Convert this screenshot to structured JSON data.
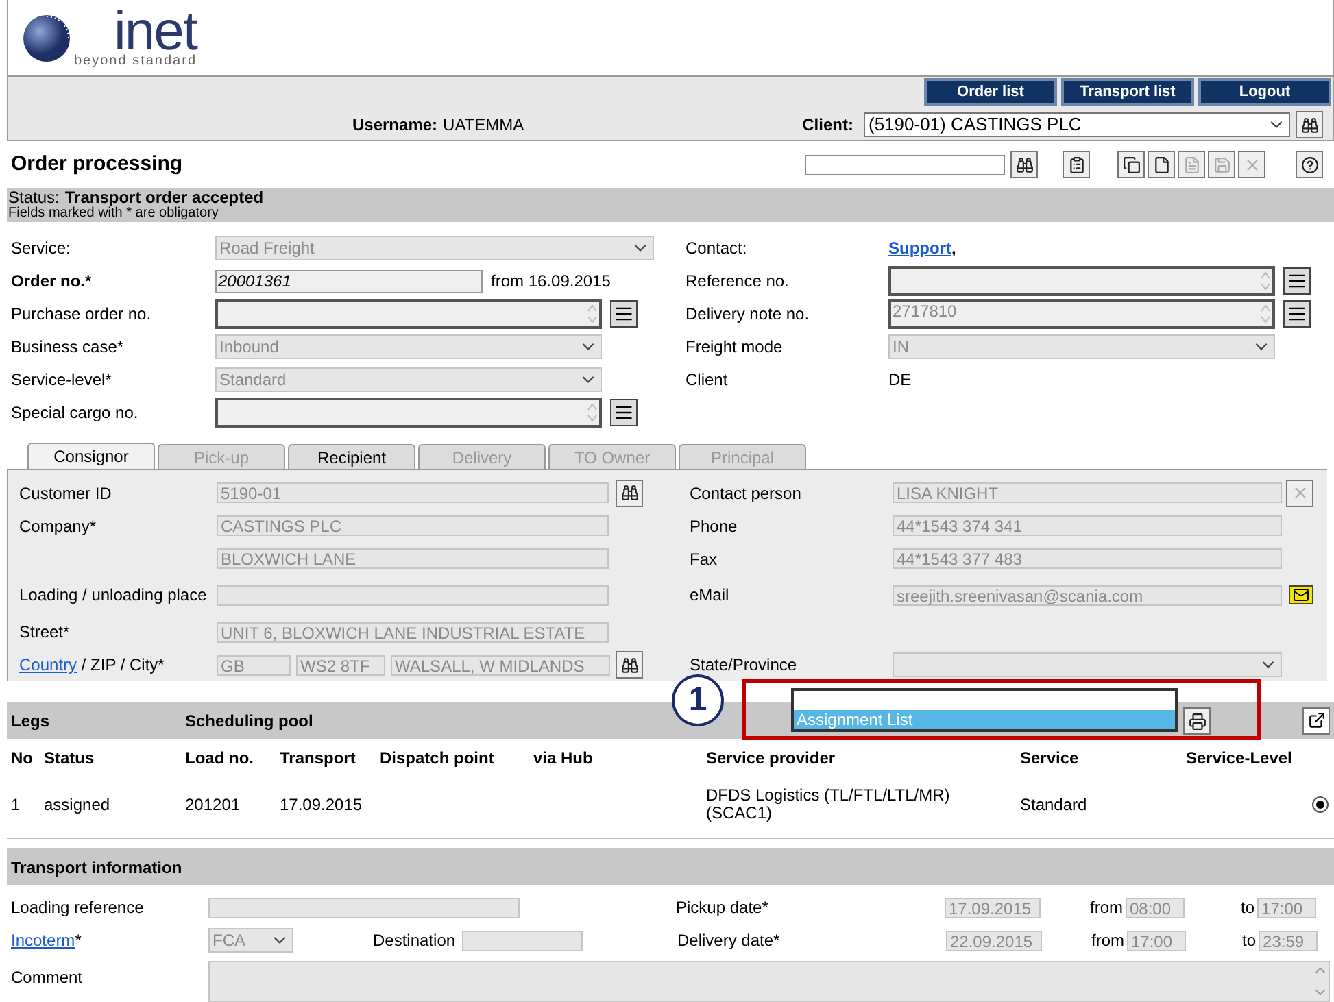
{
  "logo": {
    "wordmark": "inet",
    "tagline": "beyond standard"
  },
  "nav_buttons": [
    "Order list",
    "Transport list",
    "Logout"
  ],
  "username": {
    "label": "Username:",
    "value": "UATEMMA"
  },
  "client": {
    "label": "Client:",
    "value": "(5190-01) CASTINGS PLC"
  },
  "page_title": "Order processing",
  "status": {
    "label": "Status:",
    "value": "Transport order accepted",
    "note": "Fields marked with * are obligatory"
  },
  "order_rows": [
    {
      "left": {
        "label": "Service:",
        "primary": false,
        "kind": "select",
        "value": "Road Freight"
      },
      "right": {
        "label": "Contact:",
        "kind": "link",
        "value": "Support",
        "suffix": ","
      }
    },
    {
      "left": {
        "label": "Order no.*",
        "primary": true,
        "kind": "text",
        "value": "20001361",
        "suffix": "from 16.09.2015"
      },
      "right": {
        "label": "Reference no.",
        "kind": "spinner"
      }
    },
    {
      "left": {
        "label": "Purchase order no.",
        "primary": false,
        "kind": "spinner"
      },
      "right": {
        "label": "Delivery note no.",
        "kind": "spinner",
        "value": "2717810"
      }
    },
    {
      "left": {
        "label": "Business case*",
        "primary": false,
        "kind": "select",
        "value": "Inbound"
      },
      "right": {
        "label": "Freight mode",
        "kind": "select",
        "value": "IN"
      }
    },
    {
      "left": {
        "label": "Service-level*",
        "primary": false,
        "kind": "select",
        "value": "Standard"
      },
      "right": {
        "label": "Client",
        "kind": "static",
        "value": "DE"
      }
    },
    {
      "left": {
        "label": "Special cargo no.",
        "primary": false,
        "kind": "spinner"
      }
    }
  ],
  "tabs": [
    {
      "label": "Consignor",
      "selected": true,
      "disabled": false
    },
    {
      "label": "Pick-up",
      "selected": false,
      "disabled": true
    },
    {
      "label": "Recipient",
      "selected": false,
      "disabled": false
    },
    {
      "label": "Delivery",
      "selected": false,
      "disabled": true
    },
    {
      "label": "TO Owner",
      "selected": false,
      "disabled": true
    },
    {
      "label": "Principal",
      "selected": false,
      "disabled": true
    }
  ],
  "consignor_rows": [
    {
      "left": {
        "label": "Customer ID",
        "kind": "lookup",
        "values": [
          "5190-01"
        ]
      },
      "right": {
        "label": "Contact person",
        "kind": "clear",
        "value": "LISA KNIGHT"
      }
    },
    {
      "left": {
        "label": "Company*",
        "kind": "text",
        "values": [
          "CASTINGS PLC"
        ]
      },
      "right": {
        "label": "Phone",
        "kind": "text",
        "value": "44*1543 374 341"
      }
    },
    {
      "left": {
        "kind": "text",
        "values": [
          "BLOXWICH LANE"
        ]
      },
      "right": {
        "label": "Fax",
        "kind": "text",
        "value": "44*1543 377 483"
      }
    },
    {
      "left": {
        "label": "Loading / unloading place",
        "kind": "text"
      },
      "right": {
        "label": "eMail",
        "kind": "mail",
        "value": "sreejith.sreenivasan@scania.com"
      }
    },
    {
      "left": {
        "label": "Street*",
        "kind": "text",
        "values": [
          "UNIT 6, BLOXWICH LANE INDUSTRIAL ESTATE"
        ]
      }
    },
    {
      "left": {
        "label_link": "Country",
        "label": " / ZIP / City*",
        "kind": "address",
        "values": [
          "GB",
          "WS2 8TF",
          "WALSALL, W MIDLANDS"
        ]
      },
      "right": {
        "label": "State/Province",
        "kind": "select"
      }
    }
  ],
  "legs": {
    "title": "Legs",
    "pool": "Scheduling pool",
    "callout": "1",
    "assignment_option": "Assignment List",
    "columns": [
      "No",
      "Status",
      "Load no.",
      "Transport",
      "Dispatch point",
      "via Hub",
      "Service provider",
      "Service",
      "Service-Level"
    ],
    "rows": [
      {
        "no": "1",
        "status": "assigned",
        "load_no": "201201",
        "transport": "17.09.2015",
        "service_provider": "DFDS Logistics (TL/FTL/LTL/MR) (SCAC1)",
        "service": "Standard",
        "selected": true
      }
    ]
  },
  "transport_information": {
    "title": "Transport information",
    "loading_reference": {
      "label": "Loading reference"
    },
    "incoterm": {
      "label_link": "Incoterm",
      "label": "*",
      "value": "FCA"
    },
    "destination": {
      "label": "Destination"
    },
    "comment": {
      "label": "Comment"
    },
    "dates": [
      {
        "label": "Pickup date*",
        "date": "17.09.2015",
        "from_label": "from",
        "from": "08:00",
        "to_label": "to",
        "to": "17:00"
      },
      {
        "label": "Delivery date*",
        "date": "22.09.2015",
        "from_label": "from",
        "from": "17:00",
        "to_label": "to",
        "to": "23:59"
      }
    ]
  }
}
